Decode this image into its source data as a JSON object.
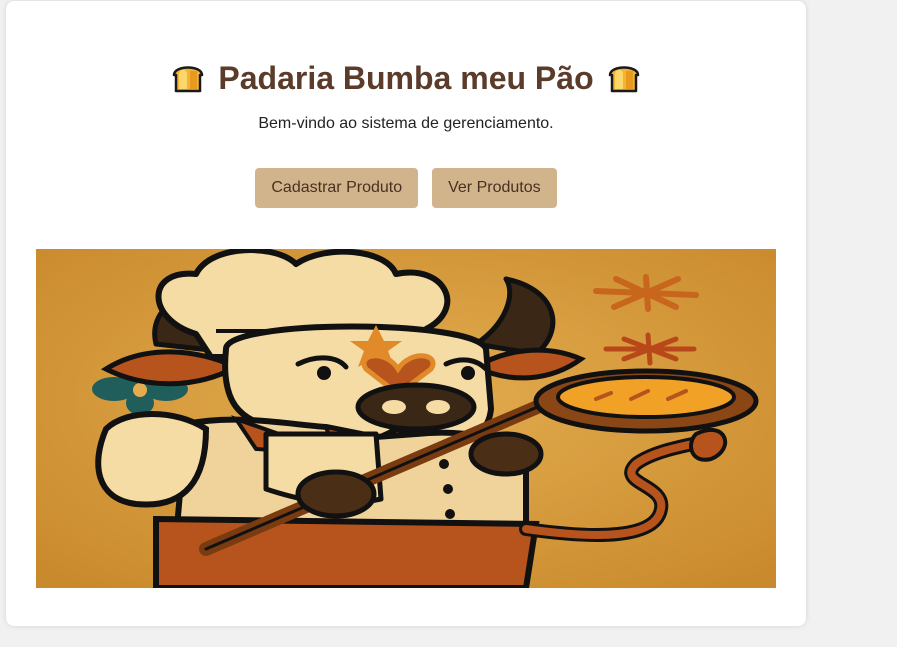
{
  "header": {
    "title": "Padaria Bumba meu Pão",
    "left_icon": "bread-icon",
    "right_icon": "bread-icon"
  },
  "subtitle": "Bem-vindo ao sistema de gerenciamento.",
  "actions": {
    "register_label": "Cadastrar Produto",
    "list_label": "Ver Produtos"
  },
  "hero": {
    "subject": "bull-chef-illustration",
    "background_color": "#d79c3b"
  },
  "colors": {
    "page_bg": "#f1f1f1",
    "card_bg": "#ffffff",
    "title": "#5b3b2a",
    "button_bg": "#d2b48c",
    "button_text": "#4a3020"
  }
}
